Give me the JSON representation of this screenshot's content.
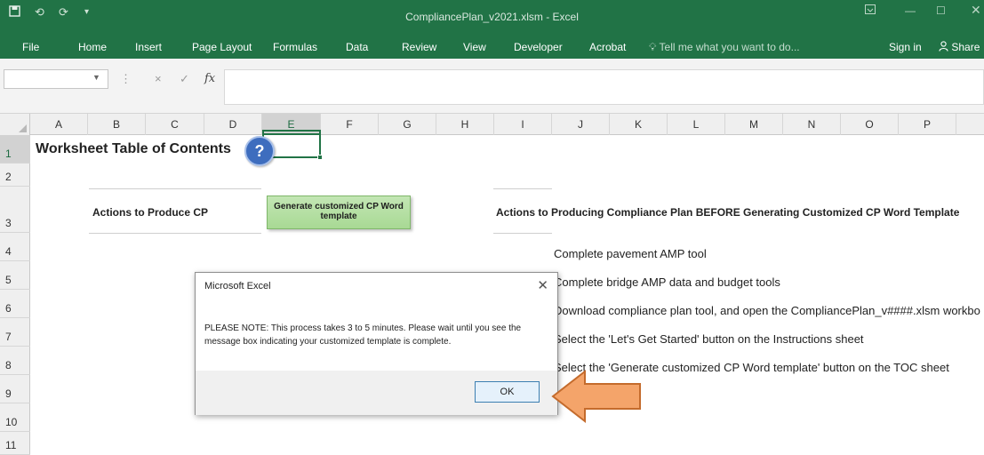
{
  "window": {
    "title": "CompliancePlan_v2021.xlsm - Excel",
    "quick_access": {
      "save_icon": "save-icon",
      "undo_icon": "undo-icon",
      "redo_icon": "redo-icon",
      "customize_icon": "customize-qat-icon"
    },
    "controls": {
      "ribbon_display_icon": "ribbon-display-icon",
      "minimize_icon": "minimize-icon",
      "maximize_icon": "maximize-icon",
      "close_icon": "close-icon"
    }
  },
  "ribbon": {
    "tabs": [
      "File",
      "Home",
      "Insert",
      "Page Layout",
      "Formulas",
      "Data",
      "Review",
      "View",
      "Developer",
      "Acrobat"
    ],
    "tell_me": "Tell me what you want to do...",
    "sign_in": "Sign in",
    "share": "Share"
  },
  "formula_bar": {
    "name_box": "",
    "formula": "",
    "cancel_symbol": "×",
    "enter_symbol": "✓",
    "fx_symbol": "fx"
  },
  "grid": {
    "columns": [
      "A",
      "B",
      "C",
      "D",
      "E",
      "F",
      "G",
      "H",
      "I",
      "J",
      "K",
      "L",
      "M",
      "N",
      "O",
      "P"
    ],
    "rows": [
      "1",
      "2",
      "3",
      "4",
      "5",
      "6",
      "7",
      "8",
      "9",
      "10",
      "11"
    ],
    "selected_column": "E",
    "selected_row": "1"
  },
  "sheet": {
    "heading": "Worksheet Table of Contents",
    "help_button": "?",
    "left_section": "Actions to Produce CP",
    "generate_button": "Generate customized CP Word template",
    "right_section": "Actions to Producing Compliance Plan BEFORE Generating Customized CP Word Template",
    "steps": [
      "Complete pavement AMP tool",
      "Complete bridge AMP data and budget tools",
      "Download compliance plan tool, and open the CompliancePlan_v####.xlsm workbo",
      "Select the 'Let's Get Started' button on the Instructions sheet",
      "Select the 'Generate customized CP Word template' button on the TOC sheet"
    ]
  },
  "dialog": {
    "title": "Microsoft Excel",
    "message": "PLEASE NOTE: This process takes 3 to 5 minutes. Please wait until you see the message box indicating your customized template is complete.",
    "ok": "OK"
  },
  "colors": {
    "excel_green": "#217346",
    "arrow_fill": "#f4a46a",
    "arrow_stroke": "#c46b2c",
    "generate_button_fill": "#a8d994",
    "help_button_fill": "#3e6dbe"
  }
}
